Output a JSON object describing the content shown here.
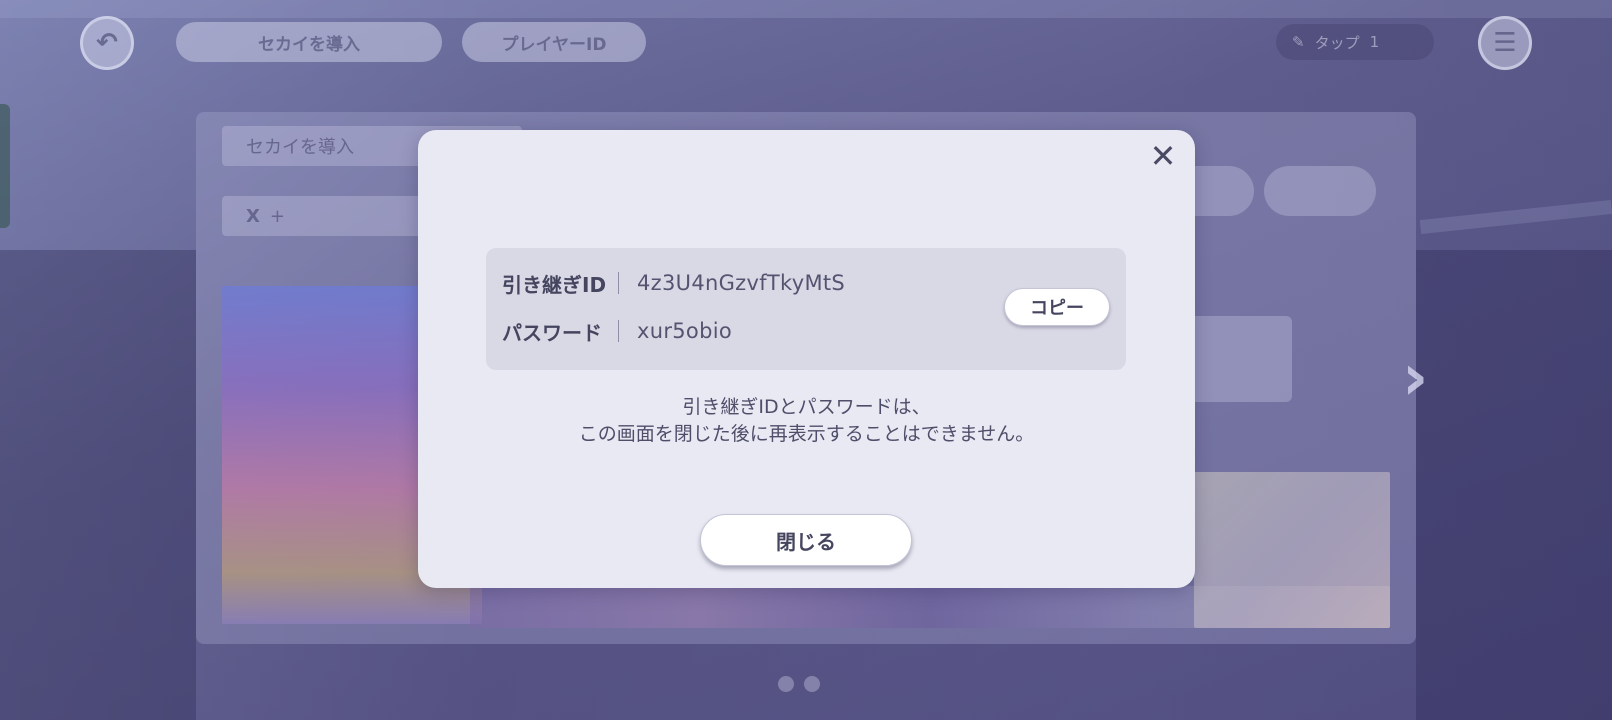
{
  "background": {
    "top_tabs": [
      "セカイを導入",
      "プレイヤーID"
    ],
    "coin_label": "タップ",
    "coin_count": "1",
    "field_label": "セカイを導入",
    "share_label": "X",
    "share_plus": "+"
  },
  "modal": {
    "close_glyph": "✕",
    "credentials": {
      "id_label": "引き継ぎID",
      "id_value": "4z3U4nGzvfTkyMtS",
      "password_label": "パスワード",
      "password_value": "xur5obio",
      "copy_label": "コピー"
    },
    "notice_line1": "引き継ぎIDとパスワードは、",
    "notice_line2": "この画面を閉じた後に再表示することはできません。",
    "close_button": "閉じる"
  },
  "colors": {
    "modal_bg": "#e8e9f2",
    "credential_box_bg": "#d9d9e6",
    "text": "#45455f",
    "overlay": "#5e5c86"
  }
}
